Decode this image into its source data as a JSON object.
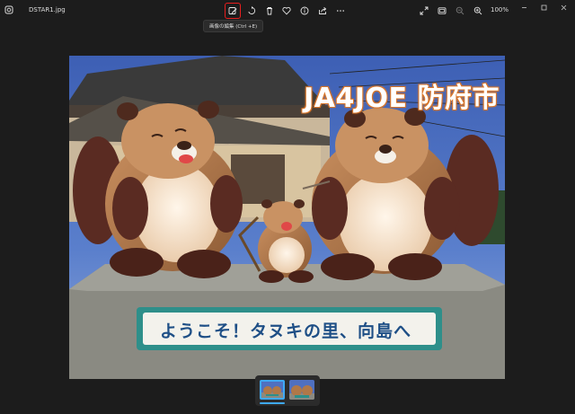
{
  "title_bar": {
    "filename": "DSTAR1.jpg",
    "zoom": "100%"
  },
  "toolbar": {
    "edit_tooltip": "画像の編集 (Ctrl +E)",
    "icons": [
      "edit-image-icon",
      "rotate-icon",
      "delete-icon",
      "favorite-icon",
      "info-icon",
      "share-icon",
      "more-icon"
    ],
    "right_icons": [
      "fullscreen-icon",
      "slideshow-icon",
      "zoom-out-icon",
      "zoom-in-icon"
    ]
  },
  "photo": {
    "caption": "JA4JOE 防府市",
    "sign": "ようこそ！タヌキの里、向島へ"
  },
  "filmstrip": {
    "thumbnail_count": 2,
    "selected_index": 0
  },
  "colors": {
    "highlight": "#e81e1e",
    "accent": "#3fa9f5",
    "background": "#1c1c1c"
  }
}
